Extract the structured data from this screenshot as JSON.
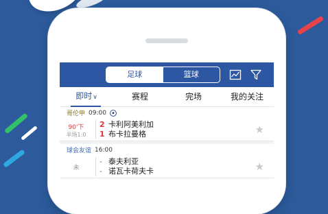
{
  "colors": {
    "background": "#2c5a9a",
    "header": "#2d57a2",
    "accent_red": "#e2343a"
  },
  "header": {
    "segments": [
      "足球",
      "篮球"
    ],
    "active_segment": "足球",
    "icons": [
      "trend-chart-icon",
      "filter-icon"
    ]
  },
  "tabs": [
    {
      "label": "即时",
      "active": true,
      "icon": "chevron-down-icon"
    },
    {
      "label": "赛程",
      "active": false
    },
    {
      "label": "完场",
      "active": false
    },
    {
      "label": "我的关注",
      "active": false
    }
  ],
  "matches": [
    {
      "league": "哥伦甲",
      "time": "09:00",
      "icon": "soccer-ball-icon",
      "status": "90'下",
      "halftime": "半场1:0",
      "home_score": "2",
      "home_team": "卡利阿美利加",
      "away_score": "1",
      "away_team": "布卡拉曼格"
    },
    {
      "league": "球会友谊",
      "time": "16:00",
      "status": "未",
      "home_score": "-",
      "home_team": "泰夫利亚",
      "away_score": "-",
      "away_team": "诺瓦卡荷夫卡"
    }
  ]
}
